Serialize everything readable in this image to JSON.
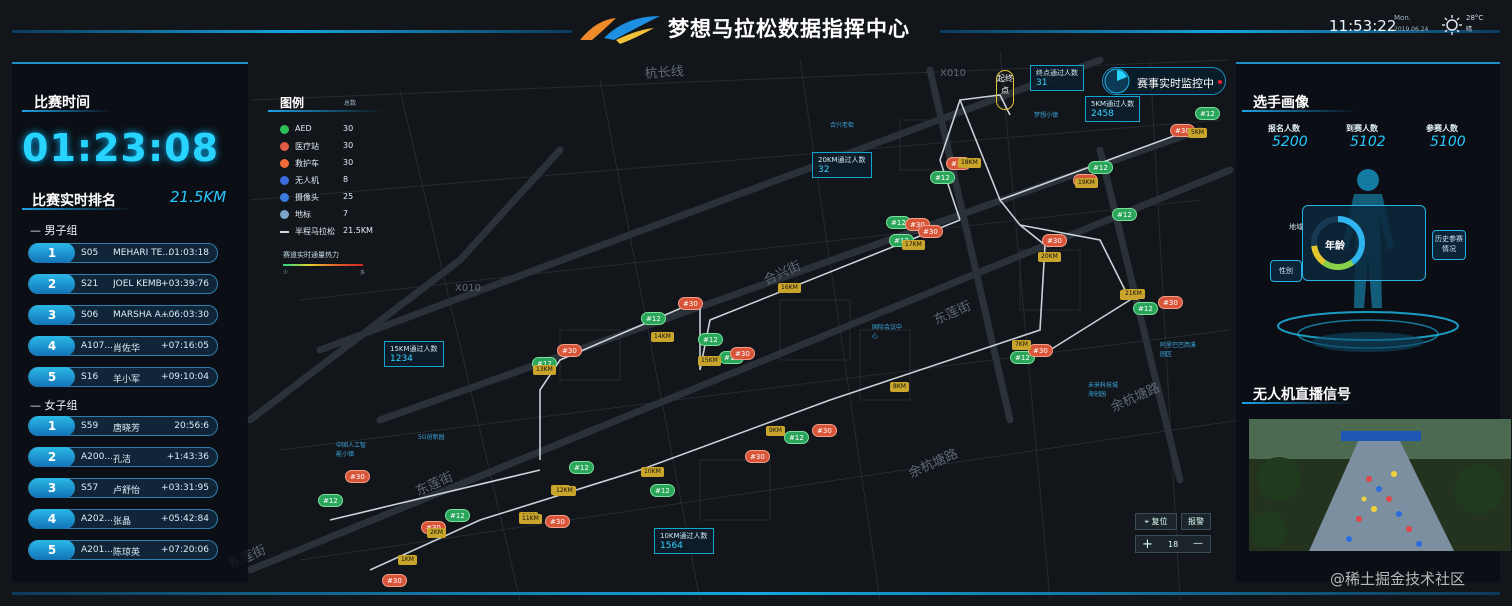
{
  "header": {
    "title": "梦想马拉松数据指挥中心",
    "clock": "11:53:22",
    "month": "Mon.",
    "date": "2019.06.24",
    "temperature": "28°C",
    "weather": "晴"
  },
  "race_time": {
    "title": "比赛时间",
    "elapsed": "01:23:08"
  },
  "ranking": {
    "title": "比赛实时排名",
    "distance": "21.5KM",
    "men_label": "男子组",
    "women_label": "女子组",
    "men": [
      {
        "rank": "1",
        "code": "S05",
        "name": "MEHARI TE...",
        "time": "01:03:18"
      },
      {
        "rank": "2",
        "code": "S21",
        "name": "JOEL KEMB",
        "time": "+03:39:76"
      },
      {
        "rank": "3",
        "code": "S06",
        "name": "MARSHA A...",
        "time": "+06:03:30"
      },
      {
        "rank": "4",
        "code": "A107...",
        "name": "肖佐华",
        "time": "+07:16:05"
      },
      {
        "rank": "5",
        "code": "S16",
        "name": "羊小军",
        "time": "+09:10:04"
      }
    ],
    "women": [
      {
        "rank": "1",
        "code": "S59",
        "name": "唐晓芳",
        "time": "20:56:6"
      },
      {
        "rank": "2",
        "code": "A200...",
        "name": "孔洁",
        "time": "+1:43:36"
      },
      {
        "rank": "3",
        "code": "S57",
        "name": "卢舒怡",
        "time": "+03:31:95"
      },
      {
        "rank": "4",
        "code": "A202...",
        "name": "张晶",
        "time": "+05:42:84"
      },
      {
        "rank": "5",
        "code": "A201...",
        "name": "陈琼英",
        "time": "+07:20:06"
      }
    ]
  },
  "legend": {
    "title": "图例",
    "count_header": "总数",
    "items": [
      {
        "label": "AED",
        "count": "30",
        "color": "#2fbf5a"
      },
      {
        "label": "医疗站",
        "count": "30",
        "color": "#e25a44"
      },
      {
        "label": "救护车",
        "count": "30",
        "color": "#f06a3a"
      },
      {
        "label": "无人机",
        "count": "8",
        "color": "#3a6ee0"
      },
      {
        "label": "摄像头",
        "count": "25",
        "color": "#3a7ce0"
      },
      {
        "label": "地标",
        "count": "7",
        "color": "#7aa4c8"
      },
      {
        "label": "半程马拉松",
        "count": "21.5KM",
        "color": "#cfdde8"
      }
    ],
    "heat_title": "赛道实时通量热力",
    "heat_low": "少",
    "heat_high": "多"
  },
  "map": {
    "roads": [
      "杭长线",
      "X010",
      "X010",
      "余杭塘路",
      "东莲街",
      "合兴街",
      "东莲街",
      "余杭塘路",
      "东莲街"
    ],
    "start_finish": "起终点",
    "monitor_label": "赛事实时监控中",
    "callouts": [
      {
        "label": "终点通过人数",
        "value": "31"
      },
      {
        "label": "5KM通过人数",
        "value": "2458"
      },
      {
        "label": "20KM通过人数",
        "value": "32"
      },
      {
        "label": "15KM通过人数",
        "value": "1234"
      },
      {
        "label": "10KM通过人数",
        "value": "1564"
      }
    ],
    "landmarks": [
      "合兴老街",
      "国际会议中心",
      "阿里巴巴西溪园区",
      "未来科技城海创园",
      "中国人工智能小镇",
      "5G创新园",
      "梦想小镇"
    ],
    "green_markers": [
      "#12",
      "#12",
      "#12",
      "#12",
      "#12",
      "#12",
      "#12",
      "#12",
      "#12",
      "#12",
      "#12",
      "#12",
      "#12",
      "#12",
      "#12",
      "#12",
      "#12"
    ],
    "red_markers": [
      "#30",
      "#30",
      "#30",
      "#30",
      "#30",
      "#30",
      "#30",
      "#30",
      "#30",
      "#30",
      "#30",
      "#30",
      "#30",
      "#30",
      "#30",
      "#30",
      "#30"
    ],
    "km_marks": [
      "1KM",
      "2KM",
      "3KM",
      "4KM",
      "5KM",
      "6KM",
      "7KM",
      "8KM",
      "9KM",
      "10KM",
      "11KM",
      "12KM",
      "13KM",
      "14KM",
      "15KM",
      "16KM",
      "17KM",
      "18KM",
      "19KM",
      "20KM",
      "21KM"
    ],
    "controls": {
      "locate": "复位",
      "alarm": "报警",
      "zoom_in": "+",
      "zoom_level": "18",
      "zoom_out": "—"
    }
  },
  "player_profile": {
    "title": "选手画像",
    "stats": [
      {
        "label": "报名人数",
        "value": "5200"
      },
      {
        "label": "到赛人数",
        "value": "5102"
      },
      {
        "label": "参赛人数",
        "value": "5100"
      }
    ],
    "tags": [
      "地域",
      "年龄",
      "性别",
      "历史参赛情况"
    ]
  },
  "drone": {
    "title": "无人机直播信号"
  },
  "watermark": "@稀土掘金技术社区"
}
